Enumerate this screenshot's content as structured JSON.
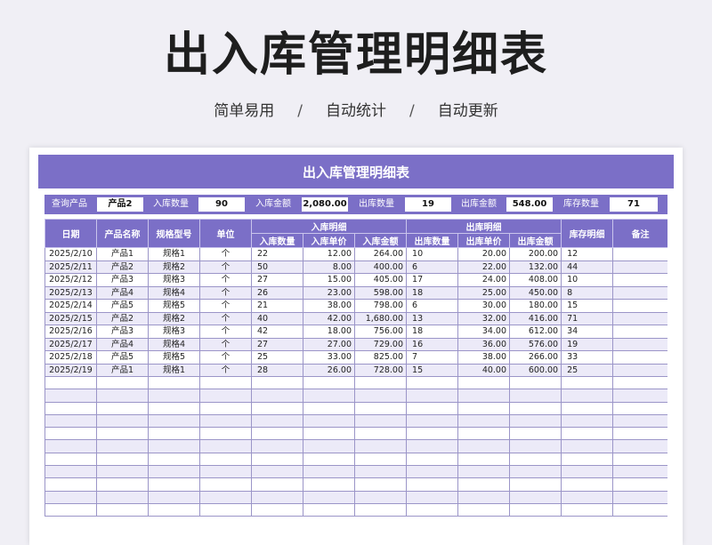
{
  "page": {
    "title": "出入库管理明细表",
    "subtitle": [
      "简单易用",
      "自动统计",
      "自动更新"
    ],
    "subtitle_sep": "/"
  },
  "sheet": {
    "banner": "出入库管理明细表",
    "query": [
      {
        "label": "查询产品",
        "value": "产品2"
      },
      {
        "label": "入库数量",
        "value": "90"
      },
      {
        "label": "入库金额",
        "value": "2,080.00"
      },
      {
        "label": "出库数量",
        "value": "19"
      },
      {
        "label": "出库金额",
        "value": "548.00"
      },
      {
        "label": "库存数量",
        "value": "71"
      }
    ],
    "headers": {
      "date": "日期",
      "product": "产品名称",
      "spec": "规格型号",
      "unit": "单位",
      "in_group": "入库明细",
      "in_qty": "入库数量",
      "in_price": "入库单价",
      "in_amount": "入库金额",
      "out_group": "出库明细",
      "out_qty": "出库数量",
      "out_price": "出库单价",
      "out_amount": "出库金额",
      "stock": "库存明细",
      "note": "备注"
    },
    "rows": [
      [
        "2025/2/10",
        "产品1",
        "规格1",
        "个",
        "22",
        "12.00",
        "264.00",
        "10",
        "20.00",
        "200.00",
        "12",
        ""
      ],
      [
        "2025/2/11",
        "产品2",
        "规格2",
        "个",
        "50",
        "8.00",
        "400.00",
        "6",
        "22.00",
        "132.00",
        "44",
        ""
      ],
      [
        "2025/2/12",
        "产品3",
        "规格3",
        "个",
        "27",
        "15.00",
        "405.00",
        "17",
        "24.00",
        "408.00",
        "10",
        ""
      ],
      [
        "2025/2/13",
        "产品4",
        "规格4",
        "个",
        "26",
        "23.00",
        "598.00",
        "18",
        "25.00",
        "450.00",
        "8",
        ""
      ],
      [
        "2025/2/14",
        "产品5",
        "规格5",
        "个",
        "21",
        "38.00",
        "798.00",
        "6",
        "30.00",
        "180.00",
        "15",
        ""
      ],
      [
        "2025/2/15",
        "产品2",
        "规格2",
        "个",
        "40",
        "42.00",
        "1,680.00",
        "13",
        "32.00",
        "416.00",
        "71",
        ""
      ],
      [
        "2025/2/16",
        "产品3",
        "规格3",
        "个",
        "42",
        "18.00",
        "756.00",
        "18",
        "34.00",
        "612.00",
        "34",
        ""
      ],
      [
        "2025/2/17",
        "产品4",
        "规格4",
        "个",
        "27",
        "27.00",
        "729.00",
        "16",
        "36.00",
        "576.00",
        "19",
        ""
      ],
      [
        "2025/2/18",
        "产品5",
        "规格5",
        "个",
        "25",
        "33.00",
        "825.00",
        "7",
        "38.00",
        "266.00",
        "33",
        ""
      ],
      [
        "2025/2/19",
        "产品1",
        "规格1",
        "个",
        "28",
        "26.00",
        "728.00",
        "15",
        "40.00",
        "600.00",
        "25",
        ""
      ]
    ],
    "blank_rows": 11,
    "colors": {
      "accent": "#7b6fc7",
      "alt_row": "#eceaf8",
      "background": "#f0eff5"
    }
  }
}
